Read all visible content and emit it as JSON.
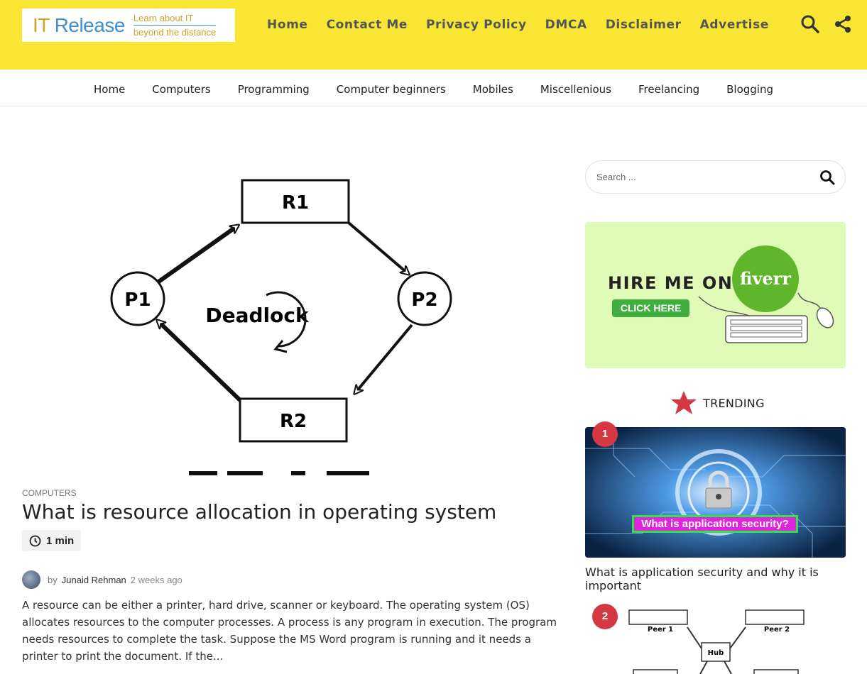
{
  "logo": {
    "brand_it": "IT",
    "brand_release": "Release",
    "tagline_1": "Learn about IT",
    "tagline_2": "beyond the distance"
  },
  "top_nav": [
    "Home",
    "Contact Me",
    "Privacy Policy",
    "DMCA",
    "Disclaimer",
    "Advertise"
  ],
  "top_icons": [
    "search-icon",
    "share-icon"
  ],
  "sub_nav": [
    "Home",
    "Computers",
    "Programming",
    "Computer beginners",
    "Mobiles",
    "Miscellenious",
    "Freelancing",
    "Blogging"
  ],
  "post": {
    "image": {
      "nodes": [
        "R1",
        "P1",
        "P2",
        "R2"
      ],
      "center_label": "Deadlock"
    },
    "category": "COMPUTERS",
    "title": "What is resource allocation in operating system",
    "read_time": "1 min",
    "author_prefix": "by",
    "author": "Junaid Rehman",
    "time_ago": "2 weeks ago",
    "excerpt": "A resource can be either a printer, hard drive, scanner or keyboard. The operating system (OS) allocates resources to the computer processes. A process is any program in execution. The program needs resources to complete the task. Suppose the MS Word program is running and it needs a printer to print the document. If the..."
  },
  "sidebar": {
    "search_placeholder": "Search ...",
    "ad": {
      "hire_text": "HIRE ME ON",
      "brand": "fiverr",
      "cta": "CLICK HERE"
    },
    "trending_label": "TRENDING",
    "trending": [
      {
        "rank": "1",
        "image_caption": "What is application security?",
        "title": "What is application security and why it is important"
      },
      {
        "rank": "2",
        "image_labels": [
          "Peer 1",
          "Peer 2",
          "Hub"
        ]
      }
    ]
  },
  "colors": {
    "header_yellow": "#f9e634",
    "accent_red": "#d33843",
    "fiverr_green": "#5fb62a",
    "ad_background": "#e0fbb7"
  }
}
